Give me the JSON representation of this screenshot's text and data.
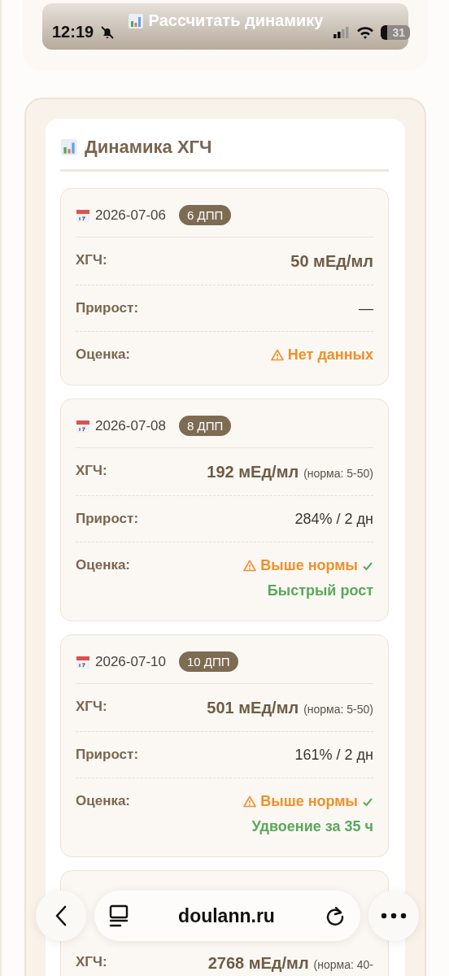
{
  "status_bar": {
    "time": "12:19",
    "battery": "31"
  },
  "calc_button": {
    "label": "Рассчитать динамику"
  },
  "section": {
    "title": "Динамика ХГЧ"
  },
  "entries": [
    {
      "date": "2026-07-06",
      "badge": "6 ДПП",
      "hcg_label": "ХГЧ:",
      "hcg": "50 мЕд/мл",
      "growth_label": "Прирост:",
      "growth": "—",
      "assessment_label": "Оценка:",
      "assessments": [
        {
          "kind": "warning",
          "text": "Нет данных"
        }
      ]
    },
    {
      "date": "2026-07-08",
      "badge": "8 ДПП",
      "hcg_label": "ХГЧ:",
      "hcg": "192 мЕд/мл",
      "norm": "(норма: 5-50)",
      "growth_label": "Прирост:",
      "growth": "284% / 2 дн",
      "assessment_label": "Оценка:",
      "assessments": [
        {
          "kind": "warning",
          "text": "Выше нормы"
        },
        {
          "kind": "ok",
          "text": "Быстрый рост"
        }
      ]
    },
    {
      "date": "2026-07-10",
      "badge": "10 ДПП",
      "hcg_label": "ХГЧ:",
      "hcg": "501 мЕд/мл",
      "norm": "(норма: 5-50)",
      "growth_label": "Прирост:",
      "growth": "161% / 2 дн",
      "assessment_label": "Оценка:",
      "assessments": [
        {
          "kind": "warning",
          "text": "Выше нормы"
        },
        {
          "kind": "ok",
          "text": "Удвоение за 35 ч"
        }
      ]
    },
    {
      "hcg_label": "ХГЧ:",
      "hcg": "2768 мЕд/мл",
      "norm": "(норма: 40-"
    }
  ],
  "browser_bar": {
    "url": "doulann.ru"
  }
}
